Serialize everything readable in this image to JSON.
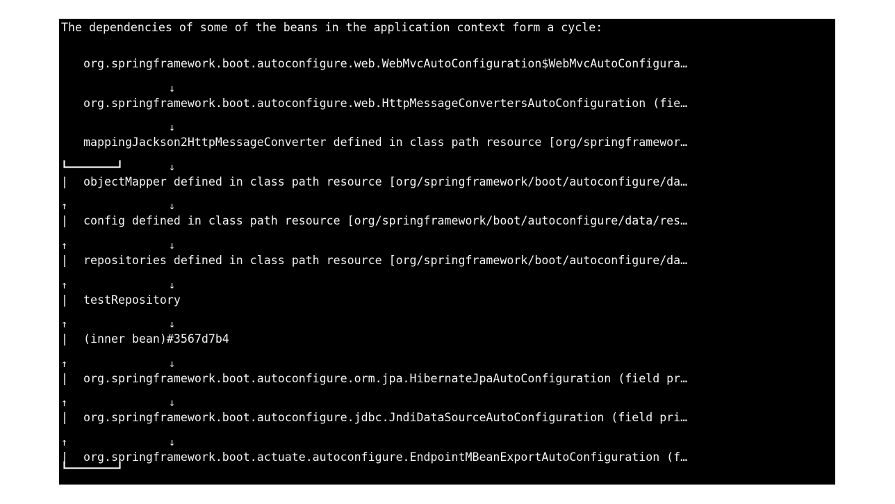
{
  "console": {
    "background_color": "#000000",
    "text_color": "#f2f2f2",
    "page_background_color": "#ffffff",
    "header": "The dependencies of some of the beans in the application context form a cycle:",
    "arrow_glyph": "↓",
    "pipe_glyph": "|",
    "up_arrow_glyph": "↑",
    "ellipsis": "…",
    "lines": [
      {
        "type": "bean",
        "text": "org.springframework.boot.autoconfigure.web.WebMvcAutoConfiguration$WebMvcAutoConfigura…",
        "truncated": true,
        "in_cycle": false
      },
      {
        "type": "bean",
        "text": "org.springframework.boot.autoconfigure.web.HttpMessageConvertersAutoConfiguration (fie…",
        "truncated": true,
        "in_cycle": false
      },
      {
        "type": "bean",
        "text": "mappingJackson2HttpMessageConverter defined in class path resource [org/springframewor…",
        "truncated": true,
        "in_cycle": false
      },
      {
        "type": "bean",
        "text": "objectMapper defined in class path resource [org/springframework/boot/autoconfigure/da…",
        "truncated": true,
        "in_cycle": true
      },
      {
        "type": "bean",
        "text": "config defined in class path resource [org/springframework/boot/autoconfigure/data/res…",
        "truncated": true,
        "in_cycle": true
      },
      {
        "type": "bean",
        "text": "repositories defined in class path resource [org/springframework/boot/autoconfigure/da…",
        "truncated": true,
        "in_cycle": true
      },
      {
        "type": "bean",
        "text": "testRepository",
        "truncated": false,
        "in_cycle": true
      },
      {
        "type": "bean",
        "text": "(inner bean)#3567d7b4",
        "truncated": false,
        "in_cycle": true
      },
      {
        "type": "bean",
        "text": "org.springframework.boot.autoconfigure.orm.jpa.HibernateJpaAutoConfiguration (field pr…",
        "truncated": true,
        "in_cycle": true
      },
      {
        "type": "bean",
        "text": "org.springframework.boot.autoconfigure.jdbc.JndiDataSourceAutoConfiguration (field pri…",
        "truncated": true,
        "in_cycle": true
      },
      {
        "type": "bean",
        "text": "org.springframework.boot.actuate.autoconfigure.EndpointMBeanExportAutoConfiguration (f…",
        "truncated": true,
        "in_cycle": true
      }
    ]
  }
}
